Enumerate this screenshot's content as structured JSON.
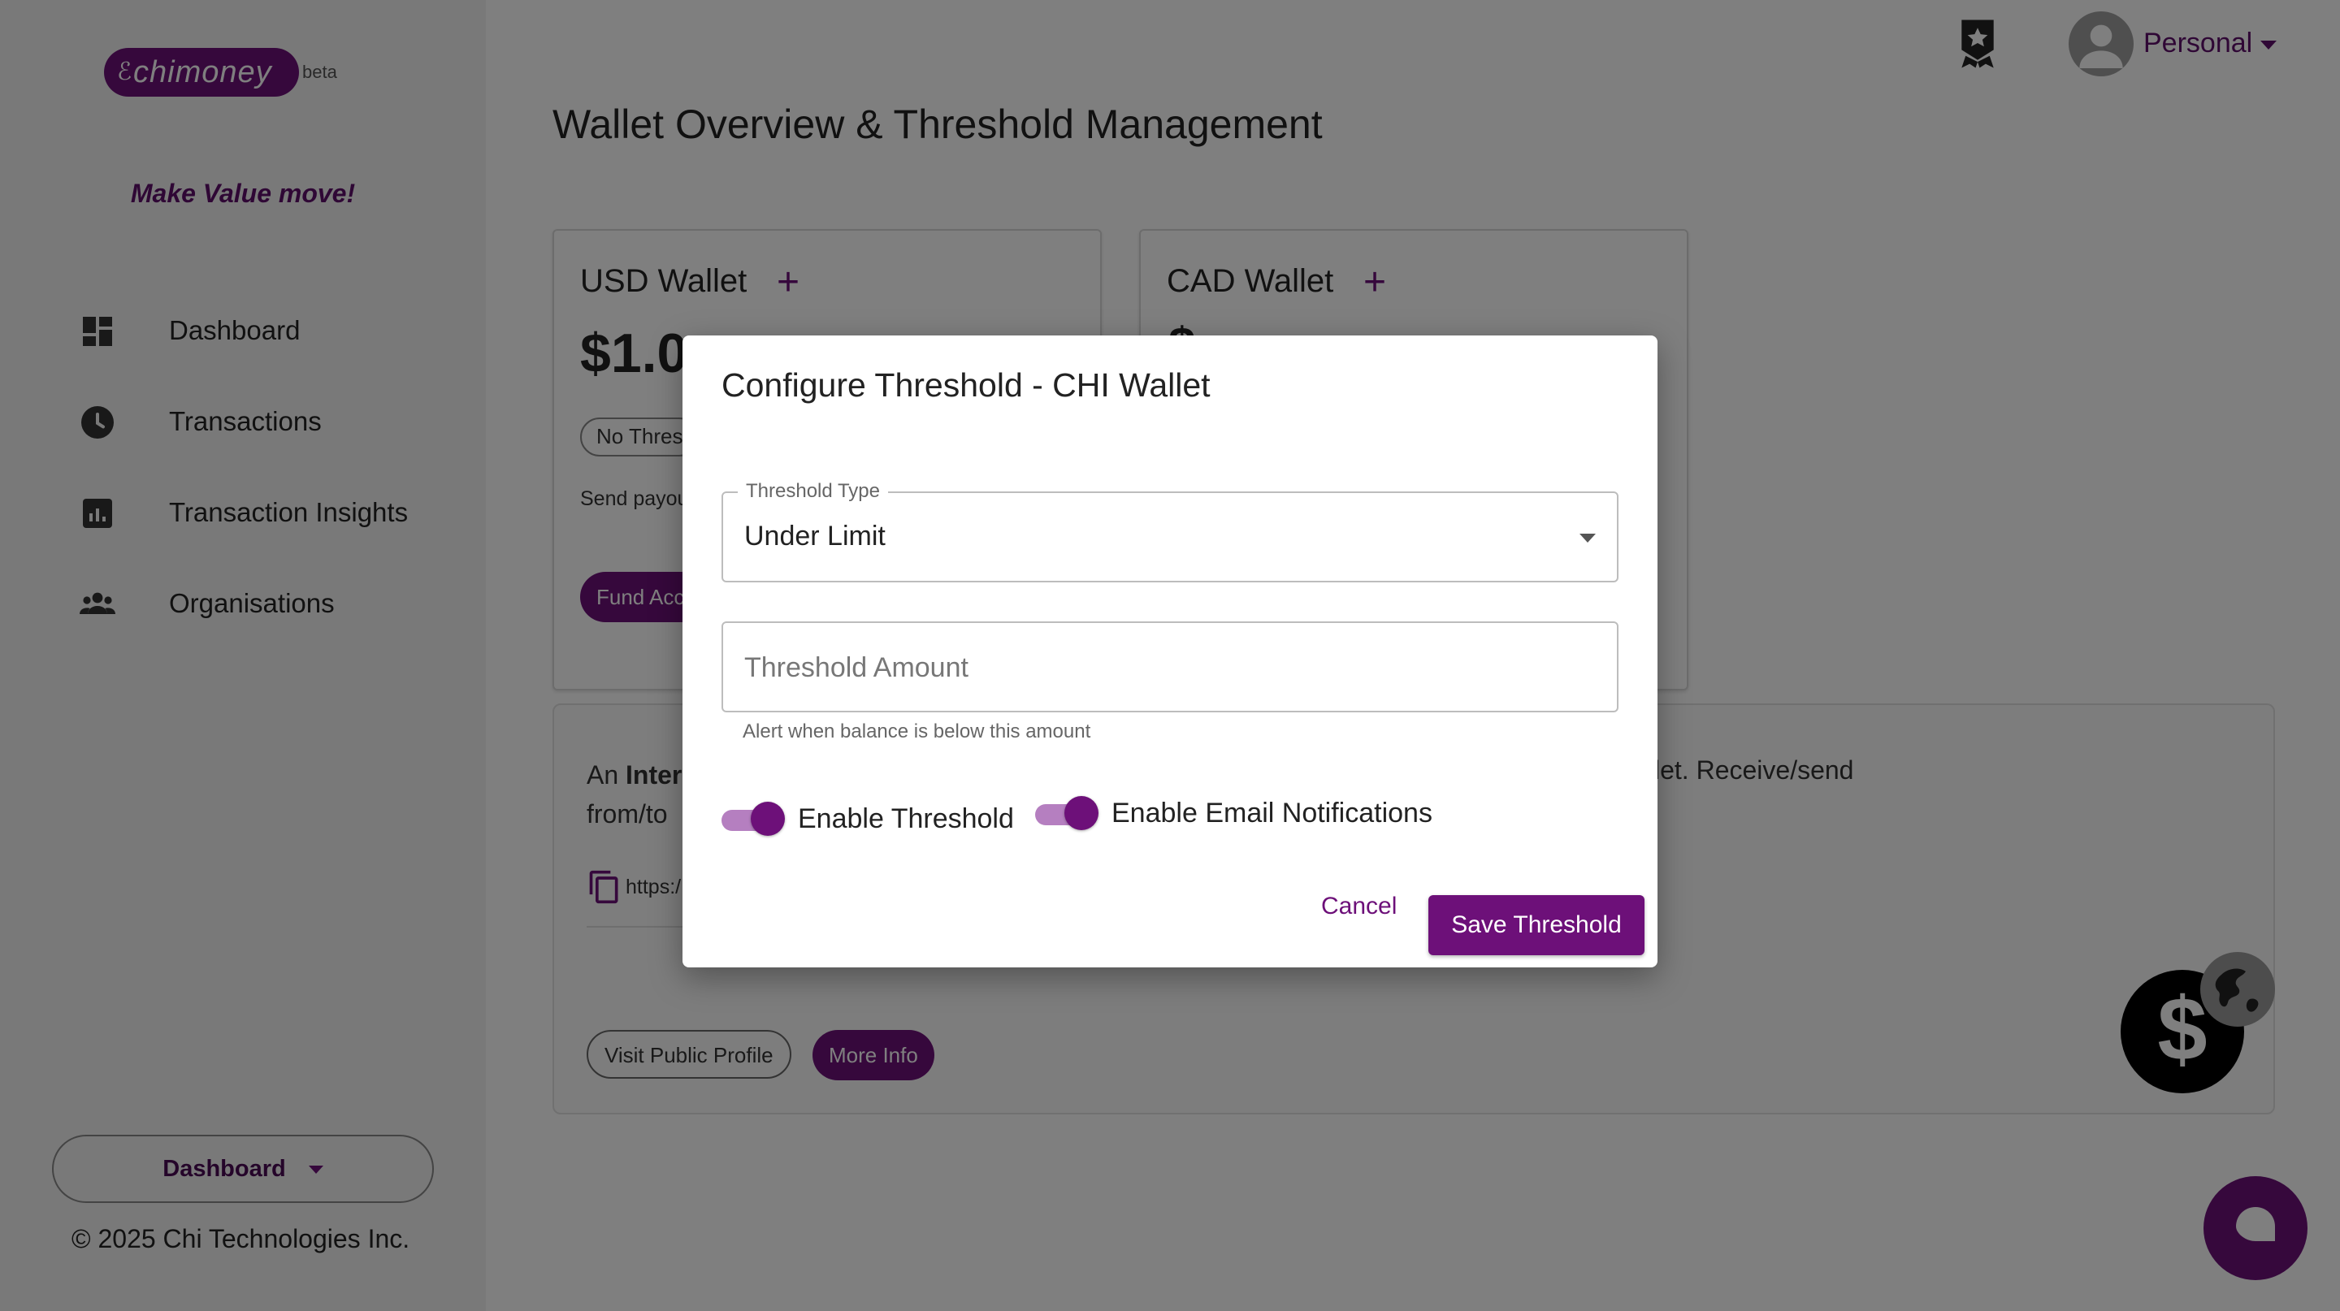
{
  "brand": {
    "logo_text": "chimoney",
    "logo_symbol": "ℰ",
    "beta_label": "beta",
    "tagline": "Make Value move!",
    "accent_color": "#6d1079"
  },
  "sidebar": {
    "items": [
      {
        "label": "Dashboard",
        "icon": "dashboard-icon"
      },
      {
        "label": "Transactions",
        "icon": "clock-icon"
      },
      {
        "label": "Transaction Insights",
        "icon": "insights-icon"
      },
      {
        "label": "Organisations",
        "icon": "group-icon"
      }
    ],
    "switcher_label": "Dashboard",
    "copyright": "© 2025 Chi Technologies Inc."
  },
  "header": {
    "profile_label": "Personal"
  },
  "main": {
    "title": "Wallet Overview & Threshold Management",
    "wallets": [
      {
        "name": "USD Wallet",
        "amount": "$1.0",
        "chip": "No Thres",
        "desc": "Send payou and more",
        "action": "Fund Acc"
      },
      {
        "name": "CAD Wallet",
        "amount": "$"
      }
    ],
    "info": {
      "left_text_prefix": "An ",
      "left_text_bold": "Inter",
      "left_text_line2": "from/to",
      "right_text": "let. Receive/send",
      "link_text": "https:/",
      "visit_button": "Visit Public Profile",
      "more_button": "More Info"
    }
  },
  "dialog": {
    "title": "Configure Threshold - CHI Wallet",
    "type_label": "Threshold Type",
    "type_value": "Under Limit",
    "amount_placeholder": "Threshold Amount",
    "amount_value": "",
    "amount_helper": "Alert when balance is below this amount",
    "toggle_threshold_label": "Enable Threshold",
    "toggle_threshold_on": true,
    "toggle_email_label": "Enable Email Notifications",
    "toggle_email_on": true,
    "cancel_label": "Cancel",
    "save_label": "Save Threshold"
  }
}
